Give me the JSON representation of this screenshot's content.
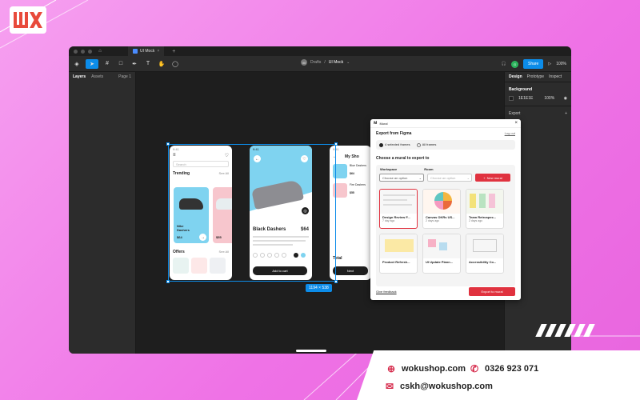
{
  "brand": {
    "logo_text": "WK"
  },
  "window": {
    "tab_title": "UI Mock",
    "breadcrumb_drafts": "Drafts",
    "breadcrumb_sep": "/",
    "file_name": "UI Mock",
    "avatar_initials": "M",
    "user_initial": "G",
    "share_label": "Share",
    "zoom": "100%"
  },
  "left_panel": {
    "tab_layers": "Layers",
    "tab_assets": "Assets",
    "page": "Page 1"
  },
  "right_panel": {
    "tabs": [
      "Design",
      "Prototype",
      "Inspect"
    ],
    "background_title": "Background",
    "bg_hex": "1E1E1E",
    "bg_opacity": "100%",
    "export_label": "Export"
  },
  "canvas": {
    "dimension_badge": "1194 × 538"
  },
  "phones": {
    "p1": {
      "search": "Search",
      "trending": "Trending",
      "see_all": "See All",
      "card_name": "Nike Dashers",
      "card_price": "$64",
      "card2_price": "$55",
      "offers": "Offers"
    },
    "p2": {
      "title": "Black Dashers",
      "price": "$64",
      "add_to_cart": "Add to cart"
    },
    "p3": {
      "title": "My Sho",
      "item1": "Blue Dashers",
      "item1_price": "$64",
      "item2": "Fire Dashers",
      "item2_price": "$55",
      "total": "Total",
      "next": "Next"
    }
  },
  "mural": {
    "app_name": "Mural",
    "export_title": "Export from Figma",
    "logout": "Log out",
    "option_selected": "4 selected frames",
    "option_all": "All frames",
    "choose_mural": "Choose a mural to export to",
    "workspace_label": "Workspace",
    "room_label": "Room",
    "workspace_placeholder": "Choose an option",
    "room_placeholder": "Choose an option",
    "new_mural": "New mural",
    "tiles": [
      {
        "name": "Design Review F...",
        "date": "7 day ago"
      },
      {
        "name": "Canvas OKRs US...",
        "date": "2 days ago"
      },
      {
        "name": "Team Retrospec...",
        "date": "2 days ago"
      },
      {
        "name": "Product Refresh...",
        "date": ""
      },
      {
        "name": "UI Update Plann...",
        "date": ""
      },
      {
        "name": "Accessibility Co...",
        "date": ""
      }
    ],
    "feedback": "Give feedback",
    "export_btn": "Export to mural"
  },
  "contact": {
    "website": "wokushop.com",
    "phone": "0326 923 071",
    "email": "cskh@wokushop.com"
  },
  "colors": {
    "accent": "#0c8ce9",
    "mural_red": "#e0323f",
    "page_bg": "#f27ae9"
  }
}
